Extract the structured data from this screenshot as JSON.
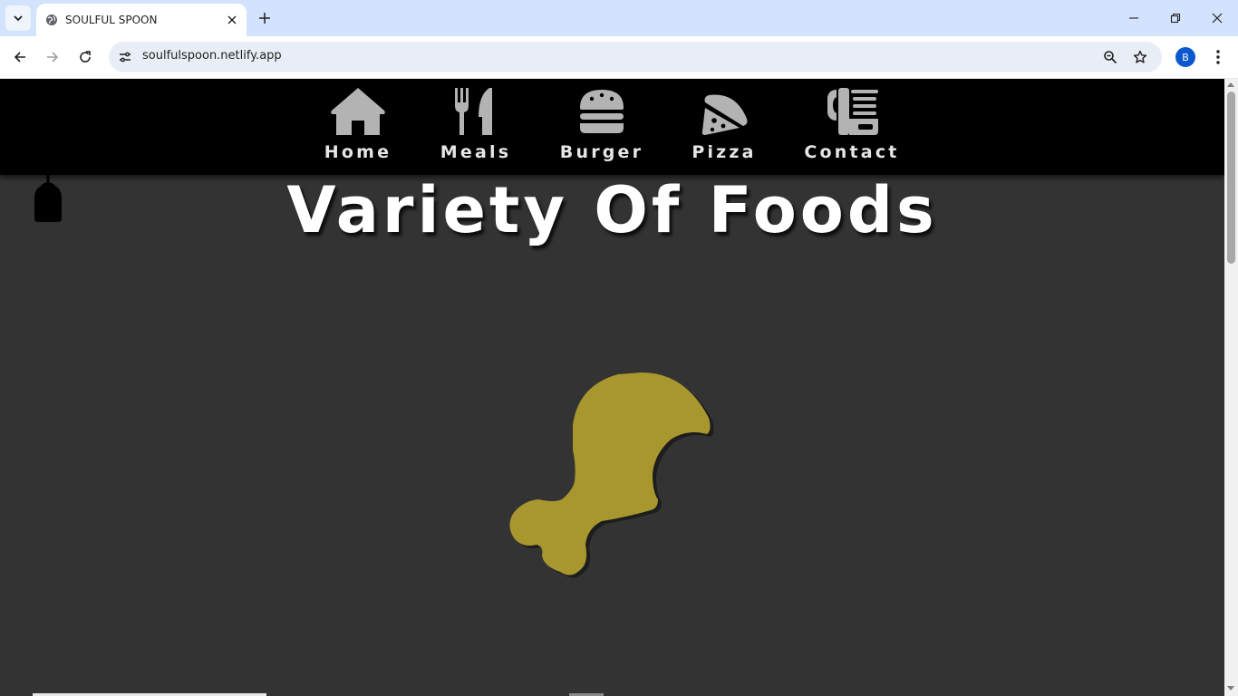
{
  "browser": {
    "tab": {
      "title": "SOULFUL SPOON",
      "favicon": "globe-icon"
    },
    "address": {
      "url": "soulfulspoon.netlify.app"
    },
    "profile": {
      "initial": "B",
      "color": "#0b57d0"
    },
    "icons": [
      "tab-search-icon",
      "close-icon",
      "plus-icon",
      "minimize-icon",
      "restore-icon",
      "window-close-icon",
      "back-arrow-icon",
      "forward-arrow-icon",
      "reload-icon",
      "site-info-icon",
      "zoom-icon",
      "star-icon",
      "kebab-menu-icon"
    ]
  },
  "site": {
    "nav": [
      {
        "label": "Home",
        "icon": "house-icon"
      },
      {
        "label": "Meals",
        "icon": "fork-knife-icon"
      },
      {
        "label": "Burger",
        "icon": "burger-icon"
      },
      {
        "label": "Pizza",
        "icon": "pizza-icon"
      },
      {
        "label": "Contact",
        "icon": "phone-fax-icon"
      }
    ],
    "hero": {
      "title": "Variety Of Foods",
      "illustration": "drumstick-icon"
    },
    "colors": {
      "nav_background": "#000000",
      "page_background": "#333333",
      "nav_icon": "#b3b3b3",
      "drumstick": "#a8972e",
      "title": "#ffffff"
    }
  }
}
